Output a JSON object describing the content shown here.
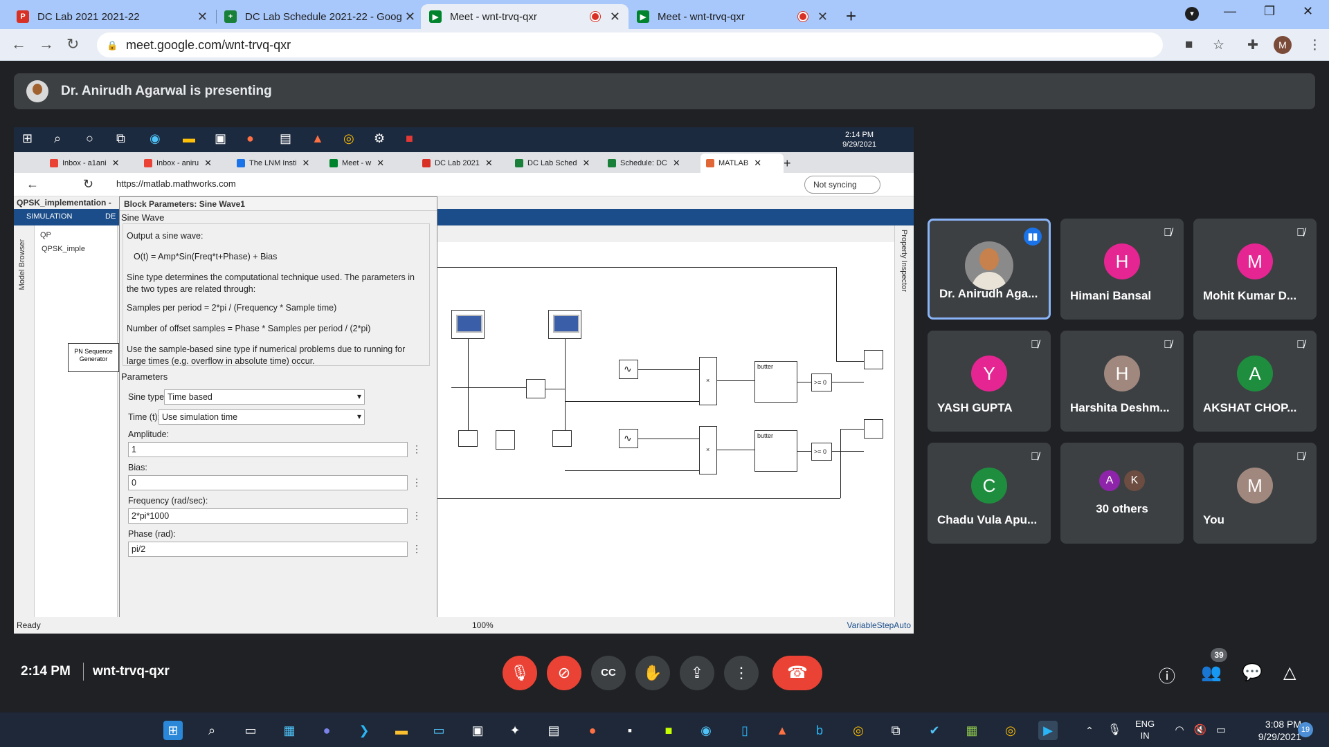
{
  "browser": {
    "tabs": [
      {
        "title": "DC Lab 2021 2021-22",
        "icon": "pdf-icon",
        "color": "#d93025",
        "recording": false
      },
      {
        "title": "DC Lab Schedule 2021-22 - Goog",
        "icon": "sheets-icon",
        "color": "#188038",
        "recording": false
      },
      {
        "title": "Meet - wnt-trvq-qxr",
        "icon": "meet-icon",
        "color": "#00832d",
        "recording": true
      },
      {
        "title": "Meet - wnt-trvq-qxr",
        "icon": "meet-icon",
        "color": "#00832d",
        "recording": true
      }
    ],
    "url": "meet.google.com/wnt-trvq-qxr",
    "profile_initial": "M"
  },
  "meet": {
    "presenting_text": "Dr. Anirudh Agarwal is presenting",
    "time": "2:14 PM",
    "code": "wnt-trvq-qxr",
    "participant_count": "39",
    "accent_color": "#8ab4f8",
    "end_call_color": "#ea4335",
    "tiles": [
      {
        "name": "Dr. Anirudh Aga...",
        "initial": "",
        "color": "#8a8a8a",
        "speaking": true,
        "muted": false
      },
      {
        "name": "Himani Bansal",
        "initial": "H",
        "color": "#e52592",
        "speaking": false,
        "muted": true
      },
      {
        "name": "Mohit Kumar D...",
        "initial": "M",
        "color": "#e52592",
        "speaking": false,
        "muted": true
      },
      {
        "name": "YASH GUPTA",
        "initial": "Y",
        "color": "#e52592",
        "speaking": false,
        "muted": true
      },
      {
        "name": "Harshita Deshm...",
        "initial": "H",
        "color": "#a1887f",
        "speaking": false,
        "muted": true
      },
      {
        "name": "AKSHAT CHOP...",
        "initial": "A",
        "color": "#1e8e3e",
        "speaking": false,
        "muted": true
      },
      {
        "name": "Chadu Vula Apu...",
        "initial": "C",
        "color": "#1e8e3e",
        "speaking": false,
        "muted": true
      },
      {
        "name": "30 others",
        "initial": "",
        "color": "",
        "speaking": false,
        "muted": false,
        "mini": [
          "A",
          "K"
        ]
      },
      {
        "name": "You",
        "initial": "M",
        "color": "#a1887f",
        "speaking": false,
        "muted": true
      }
    ]
  },
  "shared": {
    "win_clock_time": "2:14 PM",
    "win_clock_date": "9/29/2021",
    "edge_tabs": [
      {
        "title": "Inbox - a1ani",
        "color": "#ea4335"
      },
      {
        "title": "Inbox - aniru",
        "color": "#ea4335"
      },
      {
        "title": "The LNM Insti",
        "color": "#1a73e8"
      },
      {
        "title": "Meet - w",
        "color": "#00832d"
      },
      {
        "title": "DC Lab 2021",
        "color": "#d93025"
      },
      {
        "title": "DC Lab Sched",
        "color": "#188038"
      },
      {
        "title": "Schedule: DC",
        "color": "#188038"
      },
      {
        "title": "MATLAB",
        "color": "#e16737"
      }
    ],
    "edge_url": "https://matlab.mathworks.com",
    "not_syncing": "Not syncing",
    "model_title": "QPSK_implementation -",
    "ribbon": [
      "SIMULATION",
      "DE"
    ],
    "model_browser": "Model Browser",
    "tree_item": "QPSK_imple",
    "breadcrumb": "QP",
    "property_inspector": "Property Inspector",
    "status_ready": "Ready",
    "zoom": "100%",
    "solver": "VariableStepAuto",
    "pn_block": "PN Sequence Generator",
    "filter_label": "butter",
    "compare_label": ">= 0",
    "dialog": {
      "title": "Block Parameters: Sine Wave1",
      "block_name": "Sine Wave",
      "desc1": "Output a sine wave:",
      "formula": "O(t) = Amp*Sin(Freq*t+Phase) + Bias",
      "desc2": "Sine type determines the computational technique used. The parameters in the two types are related through:",
      "desc3": "Samples per period = 2*pi / (Frequency * Sample time)",
      "desc4": "Number of offset samples = Phase * Samples per period / (2*pi)",
      "desc5": "Use the sample-based sine type if numerical problems due to running for large times (e.g. overflow in absolute time) occur.",
      "params_header": "Parameters",
      "sine_type_label": "Sine type:",
      "sine_type_value": "Time based",
      "time_label": "Time (t):",
      "time_value": "Use simulation time",
      "amplitude_label": "Amplitude:",
      "amplitude_value": "1",
      "bias_label": "Bias:",
      "bias_value": "0",
      "freq_label": "Frequency (rad/sec):",
      "freq_value": "2*pi*1000",
      "phase_label": "Phase (rad):",
      "phase_value": "pi/2"
    }
  },
  "taskbar": {
    "lang": "ENG",
    "region": "IN",
    "time": "3:08 PM",
    "date": "9/29/2021",
    "notifications": "19"
  }
}
